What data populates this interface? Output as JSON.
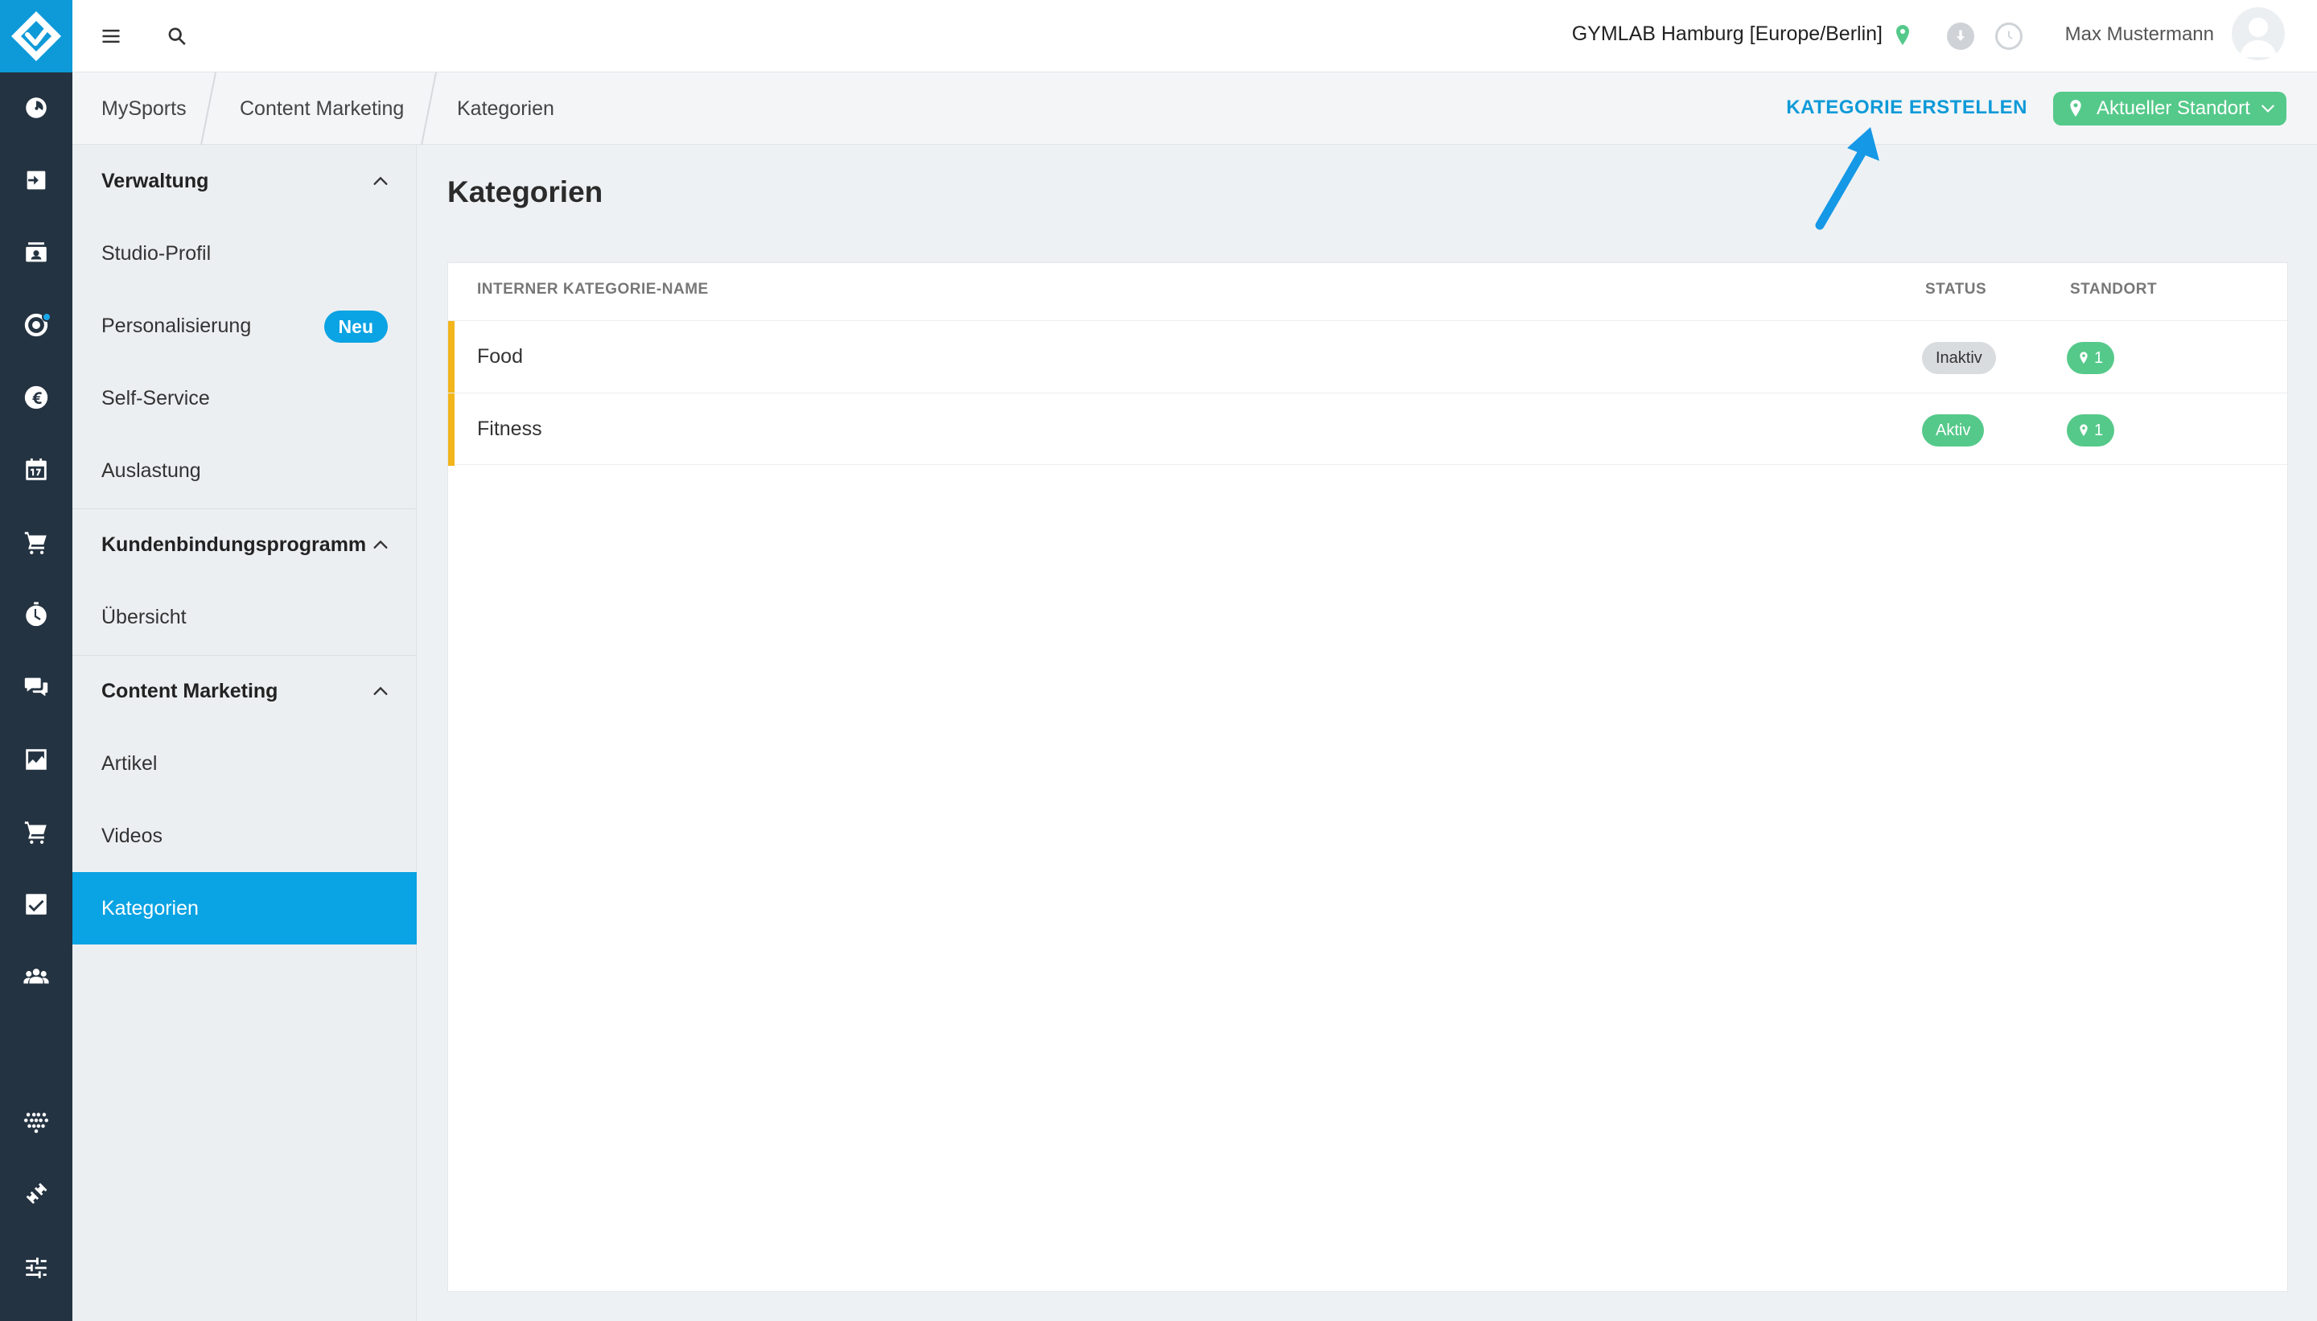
{
  "topbar": {
    "studio_name": "GYMLAB Hamburg [Europe/Berlin]",
    "user_name": "Max Mustermann"
  },
  "breadcrumb": {
    "items": [
      "MySports",
      "Content Marketing",
      "Kategorien"
    ]
  },
  "actions": {
    "create_label": "KATEGORIE ERSTELLEN",
    "location_label": "Aktueller Standort"
  },
  "sidebar": {
    "sections": [
      {
        "title": "Verwaltung",
        "items": [
          {
            "label": "Studio-Profil"
          },
          {
            "label": "Personalisierung",
            "badge": "Neu"
          },
          {
            "label": "Self-Service"
          },
          {
            "label": "Auslastung"
          }
        ]
      },
      {
        "title": "Kundenbindungsprogramm",
        "items": [
          {
            "label": "Übersicht"
          }
        ]
      },
      {
        "title": "Content Marketing",
        "items": [
          {
            "label": "Artikel"
          },
          {
            "label": "Videos"
          },
          {
            "label": "Kategorien",
            "active": true
          }
        ]
      }
    ]
  },
  "main": {
    "title": "Kategorien",
    "table": {
      "columns": [
        "INTERNER KATEGORIE-NAME",
        "STATUS",
        "STANDORT"
      ],
      "rows": [
        {
          "name": "Food",
          "status": "Inaktiv",
          "locations": "1"
        },
        {
          "name": "Fitness",
          "status": "Aktiv",
          "locations": "1"
        }
      ]
    }
  },
  "rail_icons": [
    "dashboard-icon",
    "checkin-icon",
    "contacts-icon",
    "settings-notification-icon",
    "euro-icon",
    "calendar-icon",
    "cart-icon",
    "stopwatch-icon",
    "chat-icon",
    "image-icon",
    "shop-icon",
    "checkbox-icon",
    "group-icon",
    "grid-dots-icon",
    "dumbbell-icon",
    "sliders-icon"
  ],
  "colors": {
    "rail": "#243341",
    "accent": "#0aa3e3",
    "green": "#55c98a",
    "row_marker": "#f2b51c"
  }
}
